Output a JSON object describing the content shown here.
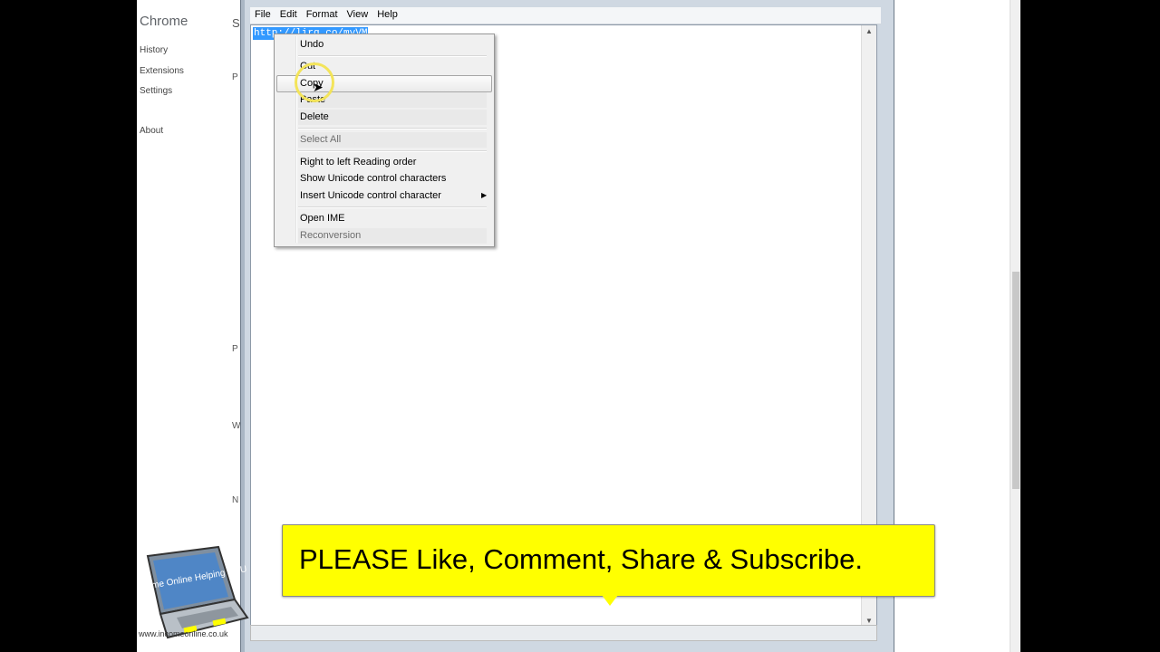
{
  "chrome": {
    "title": "Chrome",
    "nav": [
      "History",
      "Extensions",
      "Settings",
      "About"
    ],
    "cut_letters": [
      "S",
      "P",
      "P",
      "W",
      "N"
    ]
  },
  "notepad": {
    "menu": [
      "File",
      "Edit",
      "Format",
      "View",
      "Help"
    ],
    "selected_text": "http://lirq.co/myVM"
  },
  "context_menu": {
    "items": [
      {
        "label": "Undo",
        "disabled": false
      },
      {
        "label": "Cut",
        "disabled": false
      },
      {
        "label": "Copy",
        "disabled": false,
        "hovered": true
      },
      {
        "label": "Paste",
        "disabled": false
      },
      {
        "label": "Delete",
        "disabled": false
      },
      {
        "label": "Select All",
        "disabled": true
      },
      {
        "label": "Right to left Reading order",
        "disabled": false
      },
      {
        "label": "Show Unicode control characters",
        "disabled": false
      },
      {
        "label": "Insert Unicode control character",
        "disabled": false,
        "submenu": true
      },
      {
        "label": "Open IME",
        "disabled": false
      },
      {
        "label": "Reconversion",
        "disabled": true
      }
    ]
  },
  "banner": {
    "text": "PLEASE Like, Comment, Share & Subscribe.",
    "color": "#ffff00"
  },
  "logo": {
    "screen_text": "Income Online Helping YOU",
    "url": "www.incomeonline.co.uk",
    "icon": "laptop-icon"
  }
}
